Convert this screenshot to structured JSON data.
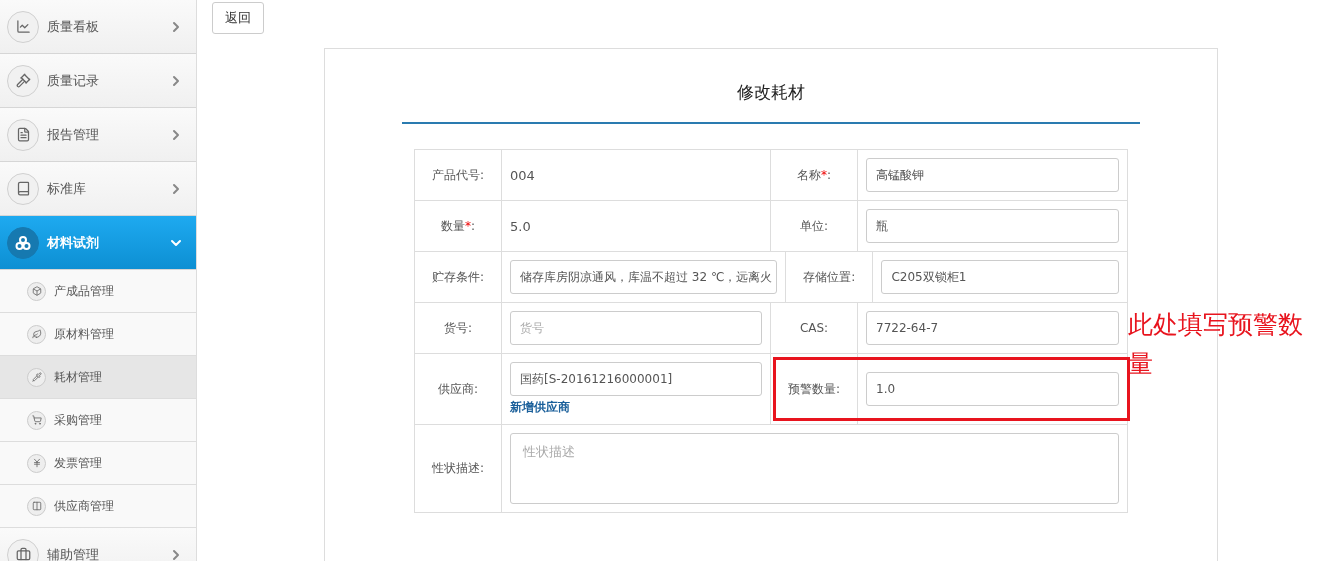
{
  "sidebar": {
    "items": [
      {
        "label": "质量看板",
        "selected": false,
        "expanded": false
      },
      {
        "label": "质量记录",
        "selected": false,
        "expanded": false
      },
      {
        "label": "报告管理",
        "selected": false,
        "expanded": false
      },
      {
        "label": "标准库",
        "selected": false,
        "expanded": false
      },
      {
        "label": "材料试剂",
        "selected": true,
        "expanded": true,
        "children": [
          {
            "label": "产成品管理",
            "selected": false
          },
          {
            "label": "原材料管理",
            "selected": false
          },
          {
            "label": "耗材管理",
            "selected": true
          },
          {
            "label": "采购管理",
            "selected": false
          },
          {
            "label": "发票管理",
            "selected": false
          },
          {
            "label": "供应商管理",
            "selected": false
          }
        ]
      },
      {
        "label": "辅助管理",
        "selected": false,
        "expanded": false
      }
    ]
  },
  "back_button": "返回",
  "form": {
    "title": "修改耗材",
    "rows": [
      {
        "fields": [
          {
            "label": "产品代号:",
            "kind": "text",
            "value": "004"
          },
          {
            "label": "名称",
            "required_mark": "*",
            "label_end": ":",
            "kind": "input",
            "value": "高锰酸钾"
          }
        ]
      },
      {
        "fields": [
          {
            "label": "数量",
            "required_mark": "*",
            "label_end": ":",
            "kind": "text",
            "value": "5.0"
          },
          {
            "label": "单位:",
            "kind": "input",
            "value": "瓶"
          }
        ]
      },
      {
        "fields": [
          {
            "label": "贮存条件:",
            "kind": "input",
            "value": "储存库房阴凉通风，库温不超过 32 ℃，远离火"
          },
          {
            "label": "存储位置:",
            "kind": "input",
            "value": "C205双锁柜1"
          }
        ]
      },
      {
        "fields": [
          {
            "label": "货号:",
            "kind": "input",
            "placeholder": "货号"
          },
          {
            "label": "CAS:",
            "kind": "input",
            "value": "7722-64-7"
          }
        ]
      },
      {
        "fields": [
          {
            "label": "供应商:",
            "kind": "input",
            "value": "国药[S-20161216000001]",
            "link": "新增供应商"
          },
          {
            "label": "预警数量:",
            "kind": "input",
            "value": "1.0",
            "highlighted": true
          }
        ]
      },
      {
        "fields": [
          {
            "label": "性状描述:",
            "kind": "textarea",
            "placeholder": "性状描述"
          }
        ]
      }
    ]
  },
  "annotation": "此处填写预警数量"
}
